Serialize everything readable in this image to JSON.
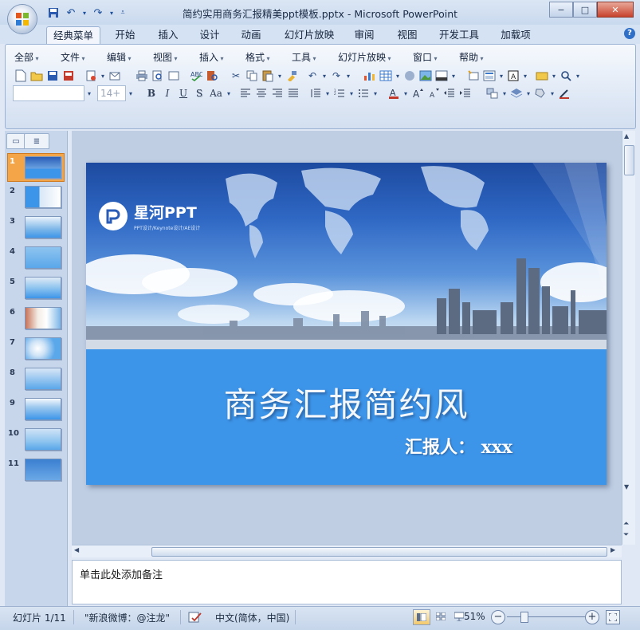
{
  "window": {
    "title": "简约实用商务汇报精美ppt模板.pptx - Microsoft PowerPoint",
    "min_label": "−",
    "max_label": "□",
    "close_label": "✕"
  },
  "quick_access": {
    "save_icon": "save-icon",
    "undo_icon": "undo-icon",
    "redo_icon": "redo-icon",
    "customize_icon": "customize-qat-icon"
  },
  "tabs": [
    {
      "label": "经典菜单",
      "active": true
    },
    {
      "label": "开始"
    },
    {
      "label": "插入"
    },
    {
      "label": "设计"
    },
    {
      "label": "动画"
    },
    {
      "label": "幻灯片放映"
    },
    {
      "label": "审阅"
    },
    {
      "label": "视图"
    },
    {
      "label": "开发工具"
    },
    {
      "label": "加载项"
    }
  ],
  "menus": [
    "全部",
    "文件",
    "编辑",
    "视图",
    "插入",
    "格式",
    "工具",
    "幻灯片放映",
    "窗口",
    "帮助"
  ],
  "format_bar": {
    "font_name": "",
    "font_size": "14+",
    "bold": "B",
    "italic": "I",
    "underline": "U",
    "shadow": "S",
    "case": "Aa"
  },
  "slides": {
    "count": 11,
    "selected": 1,
    "numbers": [
      "1",
      "2",
      "3",
      "4",
      "5",
      "6",
      "7",
      "8",
      "9",
      "10",
      "11"
    ]
  },
  "slide": {
    "brand_name": "星河PPT",
    "brand_tagline": "PPT设计/Keynote设计/AE设计",
    "title": "商务汇报简约风",
    "subtitle": "汇报人： xxx"
  },
  "notes": {
    "placeholder": "单击此处添加备注"
  },
  "status": {
    "slide_pos": "幻灯片 1/11",
    "theme": "\"新浪微博：@注龙\"",
    "language": "中文(简体，中国)",
    "zoom": "51%"
  },
  "colors": {
    "slide_band": "#3d95e9",
    "selected_thumb": "#f4a548",
    "sky_top": "#1d4aa0"
  }
}
